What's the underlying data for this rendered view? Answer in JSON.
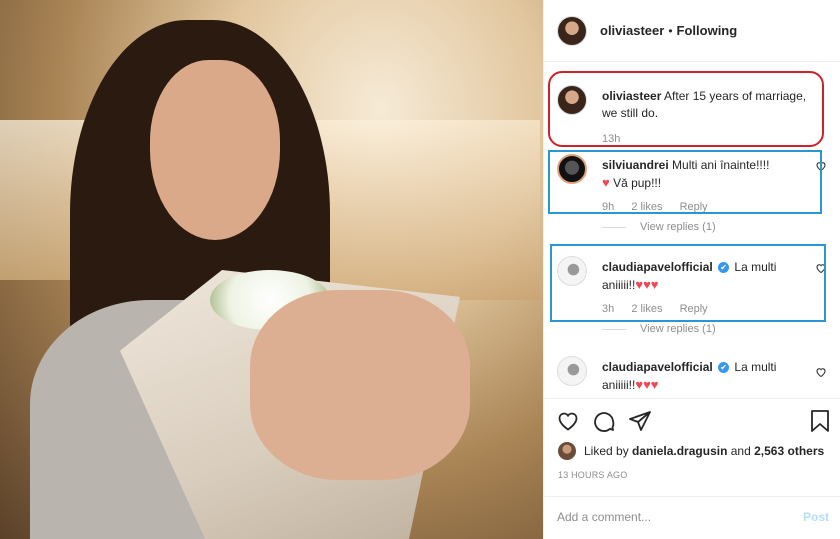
{
  "post": {
    "username": "oliviasteer",
    "separator": "•",
    "follow_status": "Following"
  },
  "caption": {
    "username": "oliviasteer",
    "text": "After 15 years of marriage, we still do.",
    "time": "13h"
  },
  "comments": [
    {
      "username": "silviuandrei",
      "text_part1": "Multi ani înainte!!!!",
      "heart": "♥",
      "text_part2": "Vă pup!!!",
      "time": "9h",
      "likes": "2 likes",
      "reply": "Reply",
      "view_replies": "View replies (1)"
    },
    {
      "username": "claudiapavelofficial",
      "verified": "✔",
      "text": "La multi aniiiii!!",
      "hearts": "♥♥♥",
      "time": "3h",
      "likes": "2 likes",
      "reply": "Reply",
      "view_replies": "View replies (1)"
    },
    {
      "username": "claudiapavelofficial",
      "verified": "✔",
      "text": "La multi aniiiii!!",
      "hearts": "♥♥♥"
    }
  ],
  "likes": {
    "prefix": "Liked by",
    "user": "daniela.dragusin",
    "and": "and",
    "count": "2,563 others"
  },
  "timestamp": "13 HOURS AGO",
  "add_comment": {
    "placeholder": "Add a comment...",
    "post_label": "Post"
  },
  "icons": {
    "like": "heart-outline-icon",
    "comment": "comment-bubble-icon",
    "share": "paper-plane-icon",
    "save": "bookmark-icon"
  },
  "colors": {
    "highlight_red": "#d21f2c",
    "highlight_blue": "#2a96d3",
    "verified_blue": "#3897f0",
    "heart_red": "#ed4956",
    "post_disabled": "#b2dffc"
  }
}
